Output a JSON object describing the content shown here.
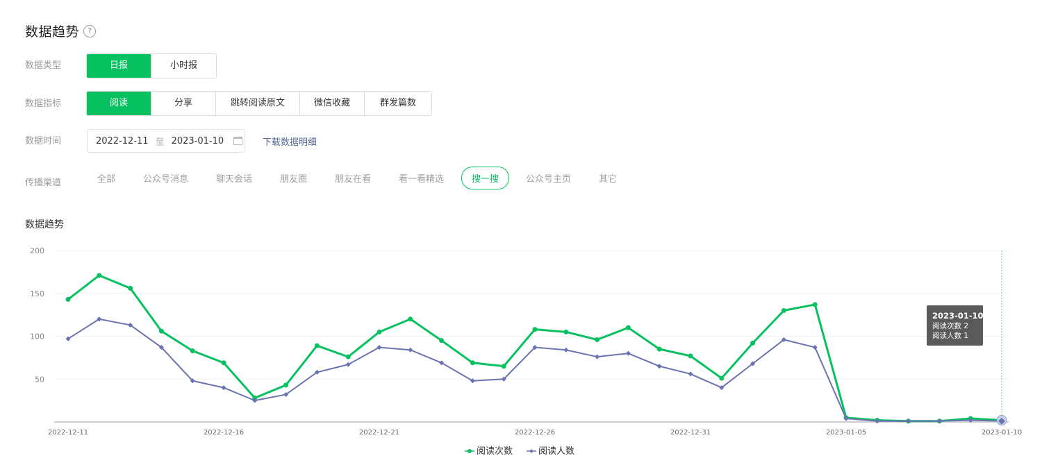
{
  "header": {
    "title": "数据趋势",
    "help_icon": "?"
  },
  "data_type": {
    "label": "数据类型",
    "options": [
      "日报",
      "小时报"
    ],
    "selected": "日报"
  },
  "metric": {
    "label": "数据指标",
    "options": [
      "阅读",
      "分享",
      "跳转阅读原文",
      "微信收藏",
      "群发篇数"
    ],
    "selected": "阅读"
  },
  "date": {
    "label": "数据时间",
    "start": "2022-12-11",
    "sep": "至",
    "end": "2023-01-10",
    "download": "下载数据明细"
  },
  "channel": {
    "label": "传播渠道",
    "options": [
      "全部",
      "公众号消息",
      "聊天会话",
      "朋友圈",
      "朋友在看",
      "看一看精选",
      "搜一搜",
      "公众号主页",
      "其它"
    ],
    "selected": "搜一搜"
  },
  "section_title": "数据趋势",
  "colors": {
    "accent": "#07c160",
    "series2": "#6a72b0",
    "link": "#576b95"
  },
  "tooltip": {
    "date": "2023-01-10",
    "line1": "阅读次数 2",
    "line2": "阅读人数 1"
  },
  "chart_data": {
    "type": "line",
    "x": [
      "2022-12-11",
      "2022-12-12",
      "2022-12-13",
      "2022-12-14",
      "2022-12-15",
      "2022-12-16",
      "2022-12-17",
      "2022-12-18",
      "2022-12-19",
      "2022-12-20",
      "2022-12-21",
      "2022-12-22",
      "2022-12-23",
      "2022-12-24",
      "2022-12-25",
      "2022-12-26",
      "2022-12-27",
      "2022-12-28",
      "2022-12-29",
      "2022-12-30",
      "2022-12-31",
      "2023-01-01",
      "2023-01-02",
      "2023-01-03",
      "2023-01-04",
      "2023-01-05",
      "2023-01-06",
      "2023-01-07",
      "2023-01-08",
      "2023-01-09",
      "2023-01-10"
    ],
    "x_ticks": [
      "2022-12-11",
      "2022-12-16",
      "2022-12-21",
      "2022-12-26",
      "2022-12-31",
      "2023-01-05",
      "2023-01-10"
    ],
    "series": [
      {
        "name": "阅读次数",
        "color": "#07c160",
        "values": [
          143,
          171,
          156,
          106,
          83,
          69,
          28,
          43,
          89,
          76,
          105,
          120,
          95,
          69,
          65,
          108,
          105,
          96,
          110,
          85,
          77,
          51,
          92,
          130,
          137,
          5,
          2,
          1,
          1,
          4,
          2
        ]
      },
      {
        "name": "阅读人数",
        "color": "#6a72b0",
        "values": [
          97,
          120,
          113,
          87,
          48,
          40,
          25,
          32,
          58,
          67,
          87,
          84,
          69,
          48,
          50,
          87,
          84,
          76,
          80,
          65,
          56,
          40,
          68,
          96,
          87,
          4,
          1,
          1,
          1,
          2,
          1
        ]
      }
    ],
    "y_ticks": [
      50,
      100,
      150,
      200
    ],
    "ylim": [
      0,
      200
    ],
    "grid": true,
    "legend": "bottom-center"
  }
}
